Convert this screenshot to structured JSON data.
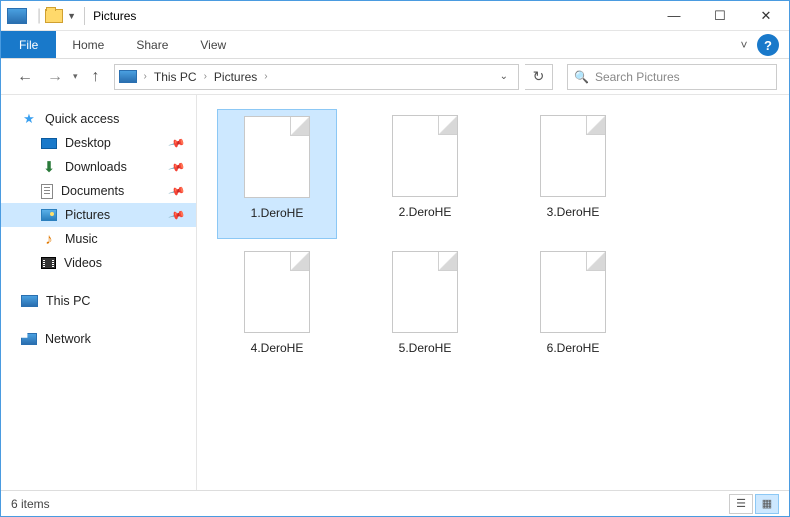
{
  "window": {
    "title": "Pictures"
  },
  "ribbon": {
    "file": "File",
    "tabs": [
      "Home",
      "Share",
      "View"
    ]
  },
  "breadcrumb": {
    "root": "This PC",
    "folder": "Pictures"
  },
  "search": {
    "placeholder": "Search Pictures"
  },
  "sidebar": {
    "quick_access": "Quick access",
    "items": [
      {
        "label": "Desktop",
        "pinned": true
      },
      {
        "label": "Downloads",
        "pinned": true
      },
      {
        "label": "Documents",
        "pinned": true
      },
      {
        "label": "Pictures",
        "pinned": true,
        "selected": true
      },
      {
        "label": "Music"
      },
      {
        "label": "Videos"
      }
    ],
    "this_pc": "This PC",
    "network": "Network"
  },
  "files": [
    {
      "name": "1.DeroHE",
      "selected": true
    },
    {
      "name": "2.DeroHE"
    },
    {
      "name": "3.DeroHE"
    },
    {
      "name": "4.DeroHE"
    },
    {
      "name": "5.DeroHE"
    },
    {
      "name": "6.DeroHE"
    }
  ],
  "status": {
    "count": "6 items"
  }
}
